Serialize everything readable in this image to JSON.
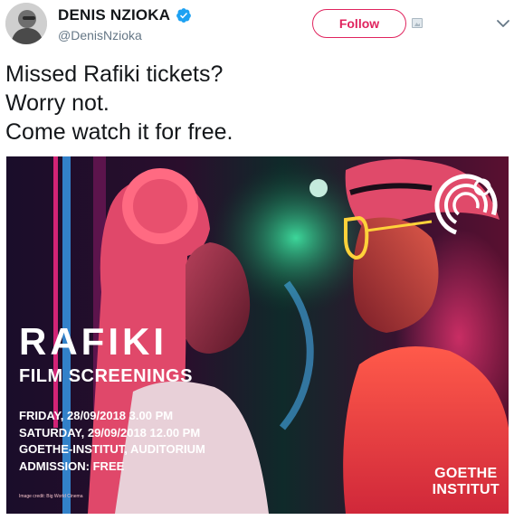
{
  "user": {
    "display_name": "DENIS NZIOKA",
    "handle": "@DenisNzioka",
    "verified": true
  },
  "actions": {
    "follow_label": "Follow",
    "menu_icon": "chevron-down-icon",
    "image_icon": "broken-image-icon"
  },
  "tweet": {
    "lines": [
      "Missed Rafiki tickets?",
      "Worry not.",
      "Come watch it for free."
    ]
  },
  "poster": {
    "title": "RAFIKI",
    "subtitle": "FILM SCREENINGS",
    "details": [
      "FRIDAY, 28/09/2018 3.00 PM",
      "SATURDAY, 29/09/2018 12.00 PM",
      "GOETHE-INSTITUT, AUDITORIUM",
      "ADMISSION: FREE"
    ],
    "credit": "Image credit: Big World Cinema",
    "brand_line1": "GOETHE",
    "brand_line2": "INSTITUT"
  },
  "colors": {
    "accent": "#e0245e",
    "verified": "#1da1f2",
    "handle": "#657786"
  }
}
